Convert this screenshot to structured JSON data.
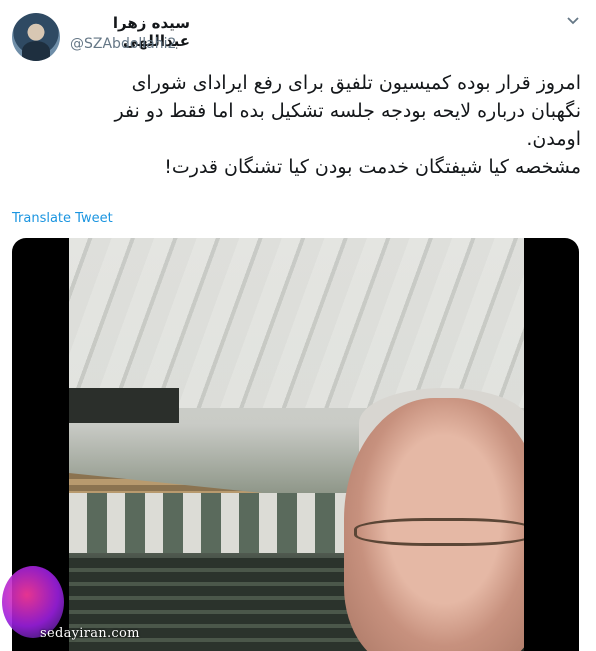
{
  "user": {
    "display_name": "سیده زهرا عبداللهی",
    "handle": "@SZAbdollahi2"
  },
  "tweet": {
    "text_lines": [
      "امروز قرار بوده کمیسیون تلفیق برای رفع ایرادای شورای",
      "نگهبان درباره لایحه بودجه جلسه تشکیل بده اما فقط دو نفر",
      "اومدن.",
      "مشخصه کیا شیفتگان خدمت بودن کیا تشنگان قدرت!"
    ],
    "translate_label": "Translate Tweet"
  },
  "icons": {
    "menu": "chevron-down-icon"
  },
  "watermark": {
    "text": "sedayiran.com"
  },
  "colors": {
    "link": "#1b95e0",
    "secondary_text": "#657786",
    "primary_text": "#14171a"
  }
}
